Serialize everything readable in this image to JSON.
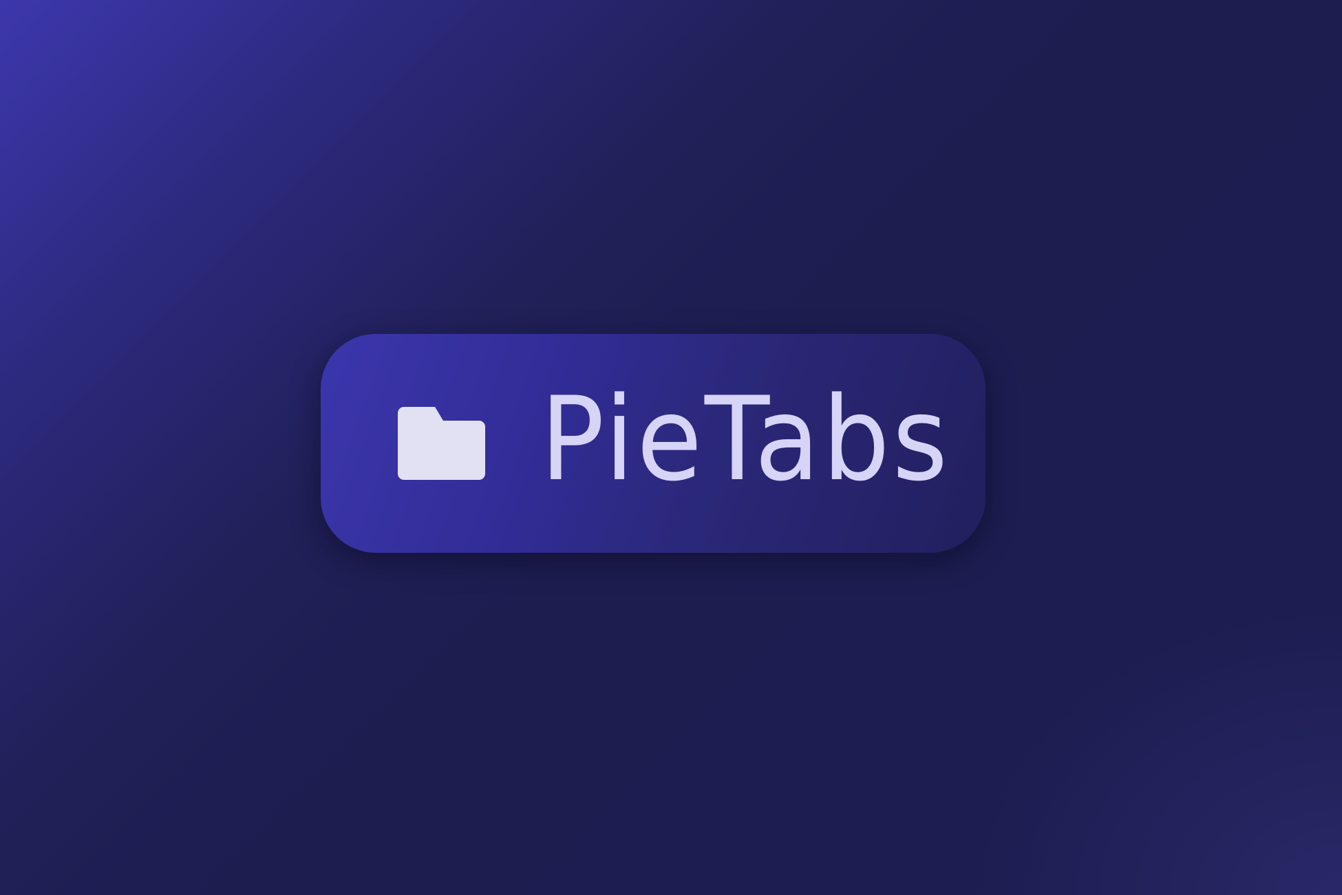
{
  "logo": {
    "icon": "folder-icon",
    "wordmark": "PieTabs"
  },
  "colors": {
    "background_start": "#3d37ad",
    "background_end": "#1d1d50",
    "badge_start": "#3c36ad",
    "badge_end": "#221f5e",
    "icon_fill": "#e2e0f3",
    "text": "#d6d4f7"
  }
}
